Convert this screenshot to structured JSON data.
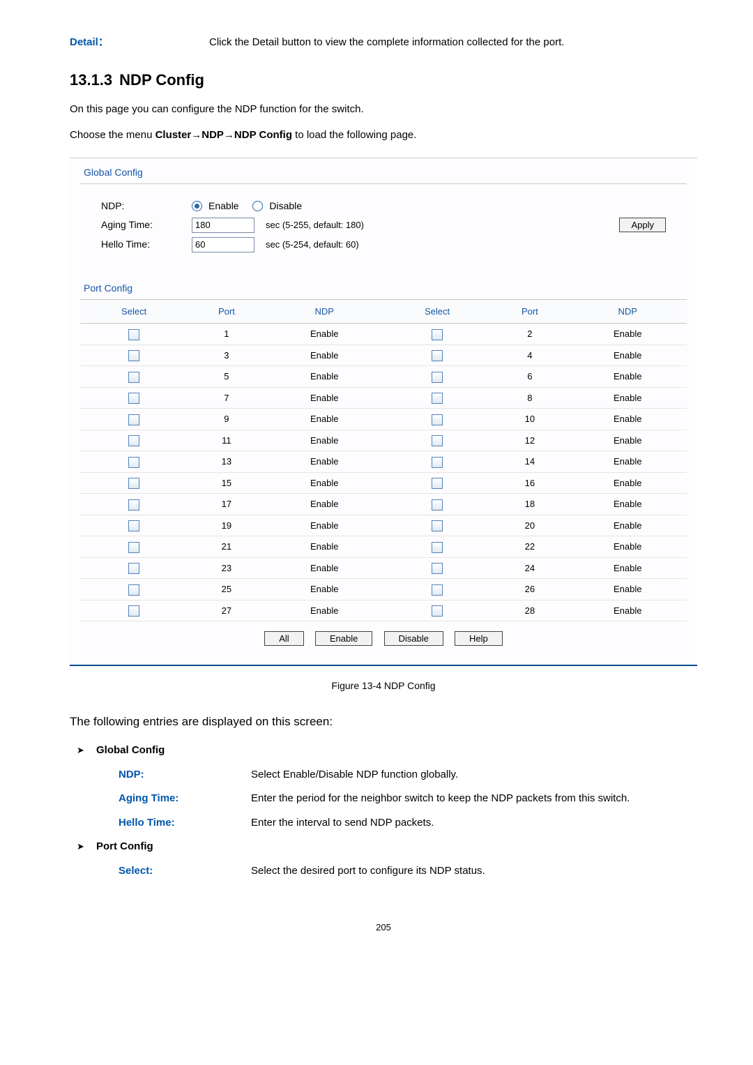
{
  "top": {
    "label": "Detail：",
    "desc": "Click the Detail button to view the complete information collected for the port."
  },
  "heading": {
    "num": "13.1.3",
    "title": "NDP Config"
  },
  "intro": "On this page you can configure the NDP function for the switch.",
  "menu_prefix": "Choose the menu ",
  "menu_bold": "Cluster→NDP→NDP Config",
  "menu_suffix": " to load the following page.",
  "ui": {
    "global_heading": "Global Config",
    "ndp_label": "NDP:",
    "enable": "Enable",
    "disable": "Disable",
    "aging_label": "Aging Time:",
    "aging_value": "180",
    "aging_hint": "sec (5-255, default: 180)",
    "hello_label": "Hello Time:",
    "hello_value": "60",
    "hello_hint": "sec (5-254, default: 60)",
    "apply": "Apply",
    "port_heading": "Port Config",
    "th": {
      "select": "Select",
      "port": "Port",
      "ndp": "NDP"
    },
    "rows": [
      {
        "p1": "1",
        "n1": "Enable",
        "p2": "2",
        "n2": "Enable"
      },
      {
        "p1": "3",
        "n1": "Enable",
        "p2": "4",
        "n2": "Enable"
      },
      {
        "p1": "5",
        "n1": "Enable",
        "p2": "6",
        "n2": "Enable"
      },
      {
        "p1": "7",
        "n1": "Enable",
        "p2": "8",
        "n2": "Enable"
      },
      {
        "p1": "9",
        "n1": "Enable",
        "p2": "10",
        "n2": "Enable"
      },
      {
        "p1": "11",
        "n1": "Enable",
        "p2": "12",
        "n2": "Enable"
      },
      {
        "p1": "13",
        "n1": "Enable",
        "p2": "14",
        "n2": "Enable"
      },
      {
        "p1": "15",
        "n1": "Enable",
        "p2": "16",
        "n2": "Enable"
      },
      {
        "p1": "17",
        "n1": "Enable",
        "p2": "18",
        "n2": "Enable"
      },
      {
        "p1": "19",
        "n1": "Enable",
        "p2": "20",
        "n2": "Enable"
      },
      {
        "p1": "21",
        "n1": "Enable",
        "p2": "22",
        "n2": "Enable"
      },
      {
        "p1": "23",
        "n1": "Enable",
        "p2": "24",
        "n2": "Enable"
      },
      {
        "p1": "25",
        "n1": "Enable",
        "p2": "26",
        "n2": "Enable"
      },
      {
        "p1": "27",
        "n1": "Enable",
        "p2": "28",
        "n2": "Enable"
      }
    ],
    "btns": {
      "all": "All",
      "enable": "Enable",
      "disable": "Disable",
      "help": "Help"
    }
  },
  "figure": "Figure 13-4 NDP Config",
  "entries_intro": "The following entries are displayed on this screen:",
  "sections": {
    "gc": "Global Config",
    "pc": "Port Config"
  },
  "defs": {
    "ndp_l": "NDP:",
    "ndp_t": "Select Enable/Disable NDP function globally.",
    "aging_l": "Aging Time:",
    "aging_t": "Enter the period for the neighbor switch to keep the NDP packets from this switch.",
    "hello_l": "Hello Time:",
    "hello_t": "Enter the interval to send NDP packets.",
    "select_l": "Select:",
    "select_t": "Select the desired port to configure its NDP status."
  },
  "page": "205"
}
